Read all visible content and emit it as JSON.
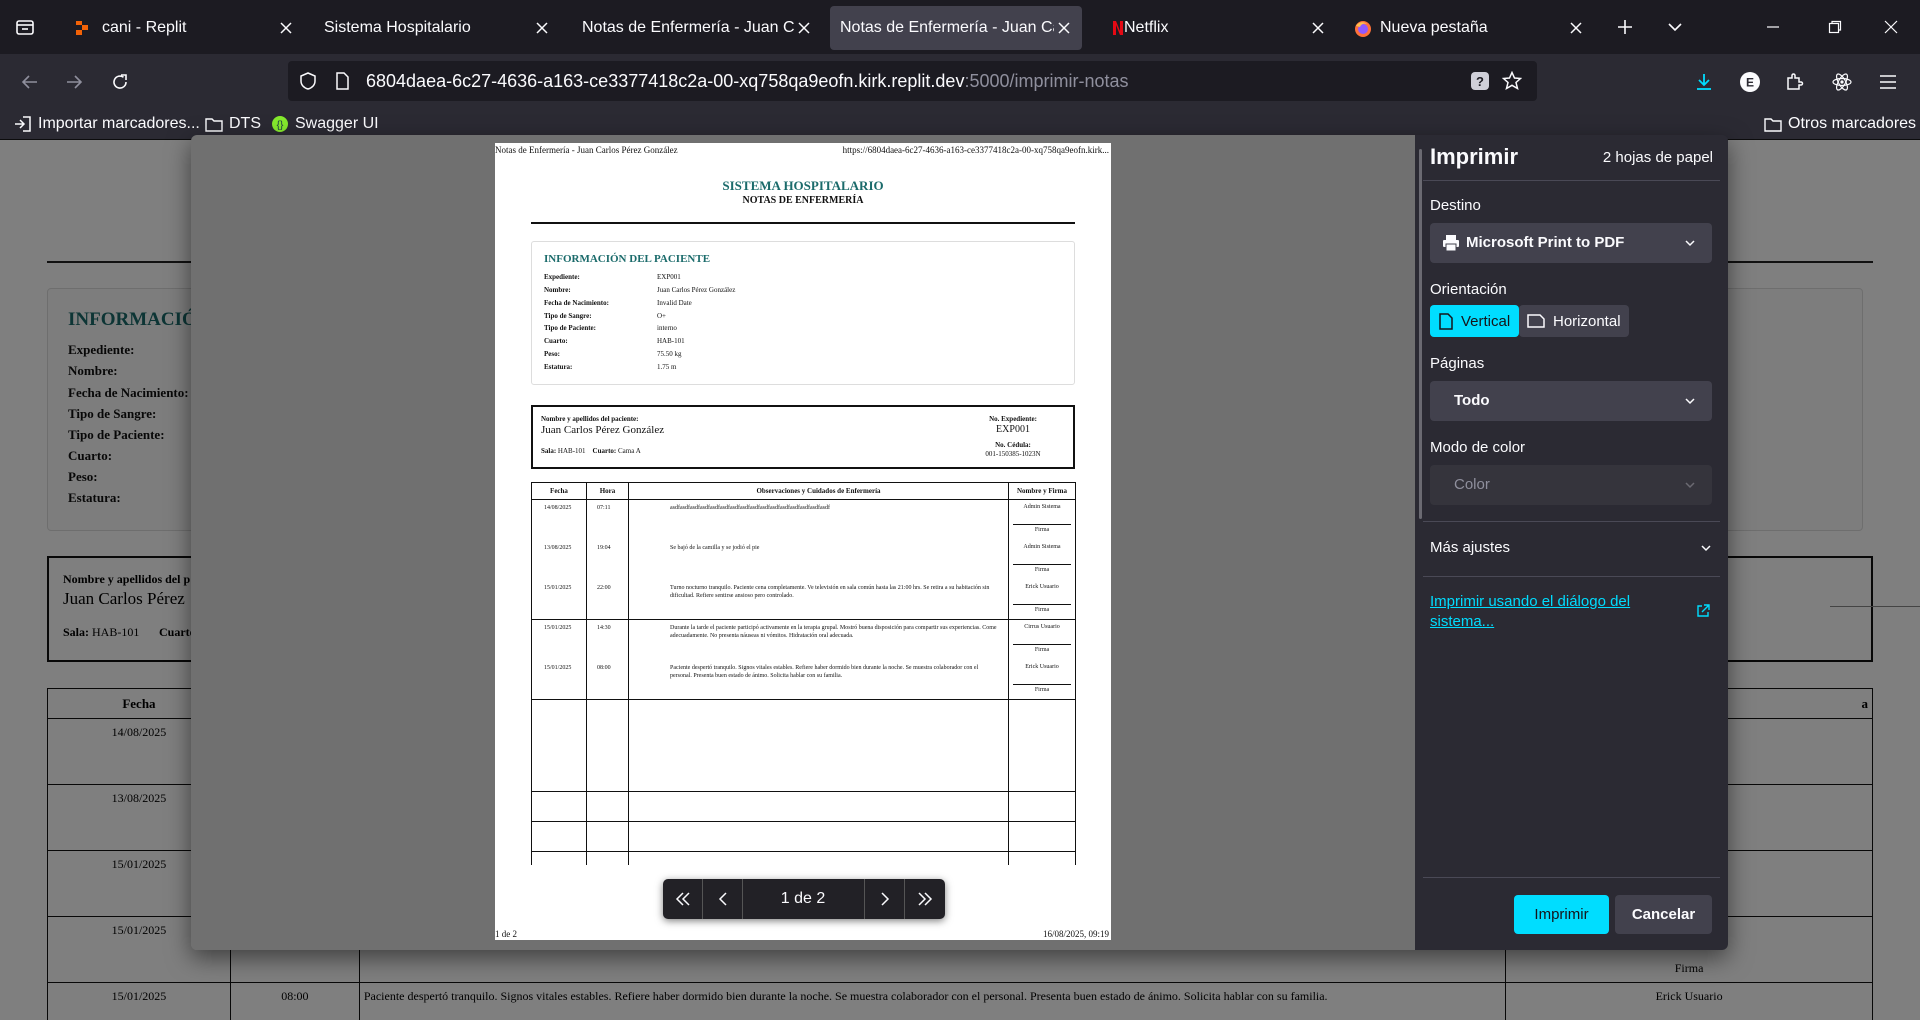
{
  "browser": {
    "tabs": [
      {
        "label": "cani - Replit",
        "icon": "replit-icon"
      },
      {
        "label": "Sistema Hospitalario",
        "icon": "none"
      },
      {
        "label": "Notas de Enfermería - Juan Carlos",
        "icon": "none"
      },
      {
        "label": "Notas de Enfermería - Juan Carlos",
        "icon": "none",
        "active": true
      },
      {
        "label": "Netflix",
        "icon": "netflix-icon"
      },
      {
        "label": "Nueva pestaña",
        "icon": "firefox-icon"
      }
    ],
    "url_main": "6804daea-6c27-4636-a163-ce3377418c2a-00-xq758qa9eofn.kirk.replit.dev",
    "url_dim": ":5000/imprimir-notas",
    "bookmarks": [
      "Importar marcadores...",
      "DTS",
      "Swagger UI"
    ],
    "other_bookmarks": "Otros marcadores"
  },
  "background_page": {
    "info_title": "INFORMACIÓN",
    "labels": [
      "Expediente:",
      "Nombre:",
      "Fecha de Nacimiento:",
      "Tipo de Sangre:",
      "Tipo de Paciente:",
      "Cuarto:",
      "Peso:",
      "Estatura:"
    ],
    "patient_label": "Nombre y apellidos del p",
    "patient_name": "Juan Carlos Pérez",
    "sala": "Sala:",
    "sala_value": "HAB-101",
    "cuarto": "Cuarto",
    "table_header_fecha": "Fecha",
    "table_header_firma_partial": "a",
    "rows": [
      {
        "fecha": "14/08/2025",
        "hora": "",
        "obs": "",
        "firma": ""
      },
      {
        "fecha": "13/08/2025",
        "hora": "",
        "obs": "",
        "firma": ""
      },
      {
        "fecha": "15/01/2025",
        "hora": "",
        "obs": "",
        "firma": ""
      },
      {
        "fecha": "15/01/2025",
        "hora": "",
        "obs": "",
        "firma": "Firma"
      },
      {
        "fecha": "15/01/2025",
        "hora": "08:00",
        "obs": "Paciente despertó tranquilo. Signos vitales estables. Refiere haber dormido bien durante la noche. Se muestra colaborador con el personal. Presenta buen estado de ánimo. Solicita hablar con su familia.",
        "firma": "Erick Usuario"
      }
    ]
  },
  "preview": {
    "header_left": "Notas de Enfermería - Juan Carlos Pérez González",
    "header_right": "https://6804daea-6c27-4636-a163-ce3377418c2a-00-xq758qa9eofn.kirk...",
    "footer_left": "1 de 2",
    "footer_right": "16/08/2025, 09:19",
    "title": "SISTEMA HOSPITALARIO",
    "subtitle": "NOTAS DE ENFERMERÍA",
    "info_title": "INFORMACIÓN DEL PACIENTE",
    "info": [
      {
        "label": "Expediente:",
        "value": "EXP001"
      },
      {
        "label": "Nombre:",
        "value": "Juan Carlos Pérez González"
      },
      {
        "label": "Fecha de Nacimiento:",
        "value": "Invalid Date"
      },
      {
        "label": "Tipo de Sangre:",
        "value": "O+"
      },
      {
        "label": "Tipo de Paciente:",
        "value": "interno"
      },
      {
        "label": "Cuarto:",
        "value": "HAB-101"
      },
      {
        "label": "Peso:",
        "value": "75.50 kg"
      },
      {
        "label": "Estatura:",
        "value": "1.75 m"
      }
    ],
    "box": {
      "name_label": "Nombre y apellidos del paciente:",
      "name": "Juan Carlos Pérez González",
      "sala_label": "Sala:",
      "sala": "HAB-101",
      "cuarto_label": "Cuarto:",
      "cuarto": "Cama A",
      "exp_label": "No. Expediente:",
      "exp": "EXP001",
      "cedula_label": "No. Cédula:",
      "cedula": "001-150385-1023N"
    },
    "table_headers": [
      "Fecha",
      "Hora",
      "Observaciones y Cuidados de Enfermería",
      "Nombre y Firma"
    ],
    "firma_word": "Firma",
    "groups": [
      {
        "entries": [
          {
            "fecha": "14/08/2025",
            "hora": "07:11",
            "obs": "asdfasdfasdfasdfasdfasdfasdfasdfasdfasdfasdfasdfasdfasdfasdfasdf",
            "firma": "Admin Sistema"
          },
          {
            "fecha": "13/08/2025",
            "hora": "19:04",
            "obs": "Se bajó de la camilla y se jodió el pie",
            "firma": "Admin Sistema"
          },
          {
            "fecha": "15/01/2025",
            "hora": "22:00",
            "obs": "Turno nocturno tranquilo. Paciente cena completamente. Ve televisión en sala común hasta las 21:00 hrs. Se retira a su habitación sin dificultad. Refiere sentirse ansioso pero controlado.",
            "firma": "Erick Usuario"
          }
        ]
      },
      {
        "entries": [
          {
            "fecha": "15/01/2025",
            "hora": "14:30",
            "obs": "Durante la tarde el paciente participó activamente en la terapia grupal. Mostró buena disposición para compartir sus experiencias. Come adecuadamente. No presenta náuseas ni vómitos. Hidratación oral adecuada.",
            "firma": "Cirrus Usuario"
          },
          {
            "fecha": "15/01/2025",
            "hora": "08:00",
            "obs": "Paciente despertó tranquilo. Signos vitales estables. Refiere haber dormido bien durante la noche. Se muestra colaborador con el personal. Presenta buen estado de ánimo. Solicita hablar con su familia.",
            "firma": "Erick Usuario"
          }
        ]
      }
    ],
    "pager": "1 de 2"
  },
  "panel": {
    "title": "Imprimir",
    "sheets": "2 hojas de papel",
    "destino_label": "Destino",
    "destino_value": "Microsoft Print to PDF",
    "orient_label": "Orientación",
    "orient_vertical": "Vertical",
    "orient_horizontal": "Horizontal",
    "pages_label": "Páginas",
    "pages_value": "Todo",
    "color_label": "Modo de color",
    "color_value": "Color",
    "more": "Más ajustes",
    "system_link": "Imprimir usando el diálogo del sistema...",
    "print_btn": "Imprimir",
    "cancel_btn": "Cancelar"
  },
  "colors": {
    "accent": "#00ddff",
    "teal": "#1b6b6b",
    "panel_bg": "#2b2a33",
    "tab_bg": "#1c1b22"
  }
}
